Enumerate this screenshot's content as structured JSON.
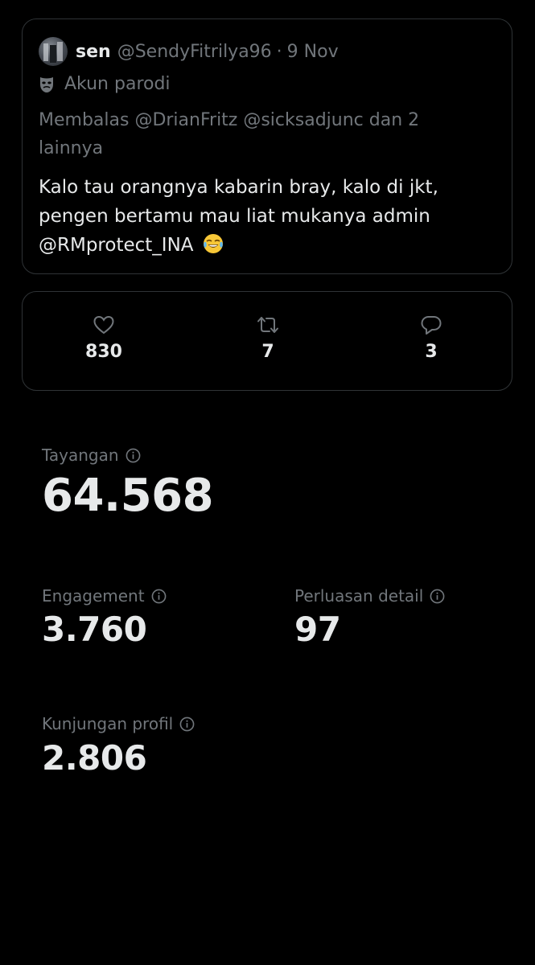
{
  "tweet": {
    "author_name": "sen",
    "author_handle": "@SendyFitrilya96",
    "separator": "·",
    "date": "9 Nov",
    "label": "Akun parodi",
    "reply_to": "Membalas @DrianFritz @sicksadjunc  dan 2 lainnya",
    "text": "Kalo tau orangnya kabarin bray, kalo di jkt, pengen bertamu mau liat mukanya admin @RMprotect_INA"
  },
  "engagement": {
    "likes": "830",
    "reposts": "7",
    "replies": "3"
  },
  "metrics": {
    "views_label": "Tayangan",
    "views_value": "64.568",
    "engagement_label": "Engagement",
    "engagement_value": "3.760",
    "detail_label": "Perluasan detail",
    "detail_value": "97",
    "profile_label": "Kunjungan profil",
    "profile_value": "2.806"
  },
  "icons": {
    "mask": "parody-mask-icon",
    "emoji": "face-with-tears-of-joy",
    "like": "heart-icon",
    "repost": "repost-icon",
    "reply": "reply-icon",
    "info": "info-icon"
  },
  "colors": {
    "background": "#000000",
    "text_primary": "#e7e9ea",
    "text_secondary": "#71767b",
    "border": "#2f3336"
  }
}
